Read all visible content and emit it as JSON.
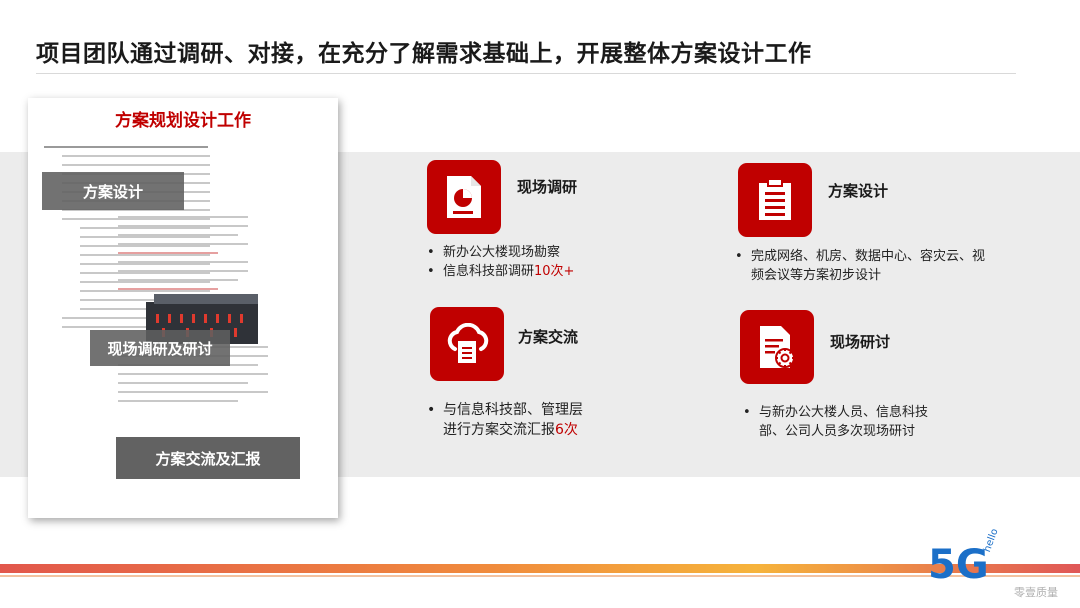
{
  "header": {
    "title": "项目团队通过调研、对接，在充分了解需求基础上，开展整体方案设计工作"
  },
  "document": {
    "title": "方案规划设计工作",
    "overlay_design": "方案设计",
    "overlay_survey": "现场调研及研讨",
    "overlay_exchange": "方案交流及汇报"
  },
  "cards": {
    "survey": {
      "title": "现场调研",
      "icon": "document-chart-icon",
      "bullet1": "新办公大楼现场勘察",
      "bullet2_prefix": "信息科技部调研",
      "bullet2_highlight": "10次+"
    },
    "design": {
      "title": "方案设计",
      "icon": "list-document-icon",
      "bullet1_line1": "完成网络、机房、数据中心、容灾云、视",
      "bullet1_line2": "频会议等方案初步设计"
    },
    "exchange": {
      "title": "方案交流",
      "icon": "cloud-document-icon",
      "bullet1": "与信息科技部、管理层",
      "bullet1_line2_prefix": "进行方案交流汇报",
      "bullet1_highlight": "6次"
    },
    "discussion": {
      "title": "现场研讨",
      "icon": "document-gear-icon",
      "bullet1_line1": "与新办公大楼人员、信息科技",
      "bullet1_line2": "部、公司人员多次现场研讨"
    }
  },
  "branding": {
    "logo": "5G",
    "logo_sub": "hello",
    "watermark": "零壹质量"
  },
  "colors": {
    "accent": "#c00000",
    "band": "#ececec"
  }
}
